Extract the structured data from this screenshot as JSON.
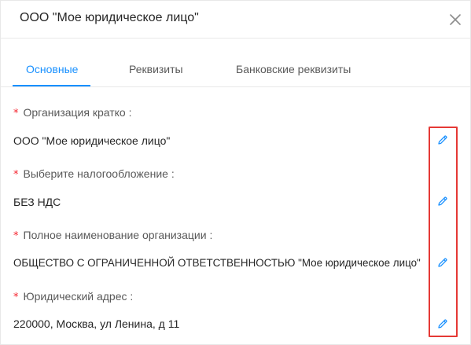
{
  "modal": {
    "title": "ООО \"Мое юридическое лицо\"",
    "close_icon": "close-icon"
  },
  "tabs": [
    {
      "label": "Основные",
      "active": true
    },
    {
      "label": "Реквизиты",
      "active": false
    },
    {
      "label": "Банковские реквизиты",
      "active": false
    }
  ],
  "fields": [
    {
      "required_mark": "*",
      "label": "Организация кратко",
      "colon": ":",
      "value": "ООО \"Мое юридическое лицо\"",
      "edit_icon": "pencil-icon"
    },
    {
      "required_mark": "*",
      "label": "Выберите налогообложение",
      "colon": ":",
      "value": "БЕЗ НДС",
      "edit_icon": "pencil-icon"
    },
    {
      "required_mark": "*",
      "label": "Полное наименование организации",
      "colon": ":",
      "value": "ОБЩЕСТВО С ОГРАНИЧЕННОЙ ОТВЕТСТВЕННОСТЬЮ \"Мое юридическое лицо\"",
      "edit_icon": "pencil-icon"
    },
    {
      "required_mark": "*",
      "label": "Юридический адрес",
      "colon": ":",
      "value": "220000, Москва, ул Ленина, д 11",
      "edit_icon": "pencil-icon"
    }
  ],
  "colors": {
    "accent": "#1890ff",
    "required": "#f5222d",
    "highlight": "#e53935",
    "label": "#595959",
    "text": "#262626"
  }
}
